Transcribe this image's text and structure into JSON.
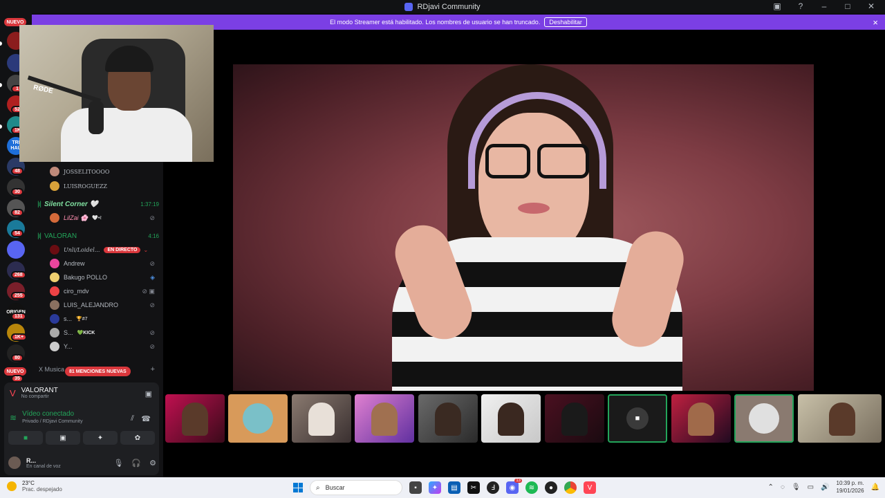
{
  "titlebar": {
    "title": "RDjavi Community"
  },
  "banner": {
    "message": "El modo Streamer está habilitado. Los nombres de usuario se han truncado.",
    "button": "Deshabilitar",
    "close_icon": "×"
  },
  "rail": {
    "nuevo_top": "NUEVO",
    "nuevo_bottom": "NUEVO",
    "badges": [
      "1",
      "52",
      "1K",
      "48",
      "30",
      "82",
      "54",
      "268",
      "255",
      "131",
      "1K+",
      "80",
      "35"
    ],
    "labels": [
      "TRI HAU",
      "ORIGEN"
    ]
  },
  "sidebar": {
    "top_users": [
      "JOSSELITOOOO",
      "LUISROGUEZZ"
    ],
    "silent_corner": {
      "name": "Silent Corner 🤍",
      "timer": "1:37:19",
      "user": "LilZai 🌸",
      "user_tag": "🤍•ℓ"
    },
    "valoran": {
      "name": "VALORAN",
      "timer": "4:16",
      "live_user": "Unli/Loidel...",
      "live_tag": "EN DIRECTO",
      "users": [
        "Andrew",
        "Bakugo POLLO",
        "ciro_mdv",
        "LUIS_ALEJANDRO",
        "s...",
        "S...",
        "Y..."
      ],
      "tags": {
        "s": "🏆#7",
        "S": "💚KICK"
      }
    },
    "musica": "X Musica",
    "mentions": "81 MENCIONES NUEVAS"
  },
  "voice": {
    "game_title": "VALORANT",
    "game_sub": "No compartir",
    "status": "Vídeo conectado",
    "channel": "Privado / RDjavi Community",
    "user_name": "R...",
    "user_status": "En canal de voz"
  },
  "webcam": {
    "mic_brand": "RØDE"
  },
  "taskbar": {
    "weather_temp": "23°C",
    "weather_desc": "Prac. despejado",
    "search_placeholder": "Buscar",
    "time": "10:39 p. m.",
    "date": "19/01/2026",
    "discord_badge": "13"
  }
}
